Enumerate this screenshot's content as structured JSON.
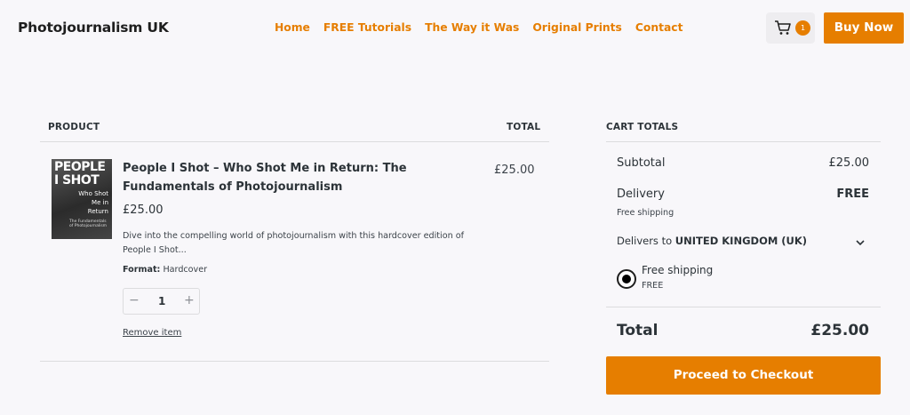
{
  "header": {
    "site_title": "Photojournalism UK",
    "nav": [
      "Home",
      "FREE Tutorials",
      "The Way it Was",
      "Original Prints",
      "Contact"
    ],
    "cart_count": "1",
    "buy_now_label": "Buy Now"
  },
  "cart": {
    "product_heading": "PRODUCT",
    "total_heading": "TOTAL",
    "item": {
      "thumbnail_text": {
        "line1": "PEOPLE",
        "line2": "I SHOT",
        "line3": "Who Shot",
        "line4": "Me in",
        "line5": "Return",
        "line6": "The Fundamentals",
        "line7": "of Photojournalism"
      },
      "name": "People I Shot – Who Shot Me in Return: The Fundamentals of Photojournalism",
      "price": "£25.00",
      "description": "Dive into the compelling world of photojournalism with this hardcover edition of People I Shot...",
      "format_label": "Format:",
      "format_value": "Hardcover",
      "quantity": "1",
      "remove_label": "Remove item",
      "line_total": "£25.00"
    }
  },
  "totals": {
    "heading": "CART TOTALS",
    "subtotal_label": "Subtotal",
    "subtotal_value": "£25.00",
    "delivery_label": "Delivery",
    "delivery_value": "FREE",
    "delivery_note": "Free shipping",
    "delivers_to_prefix": "Delivers to",
    "delivers_to_country": "UNITED KINGDOM (UK)",
    "shipping_option_label": "Free shipping",
    "shipping_option_price": "FREE",
    "total_label": "Total",
    "total_value": "£25.00",
    "checkout_label": "Proceed to Checkout"
  },
  "colors": {
    "accent": "#e67e00",
    "background": "#f8f7fa",
    "text": "#2c3338"
  }
}
